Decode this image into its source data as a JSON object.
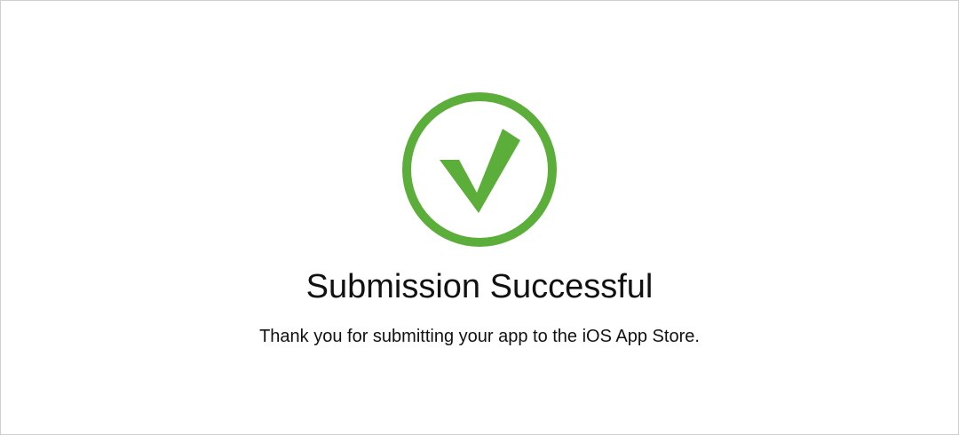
{
  "dialog": {
    "status_icon": "success-checkmark-icon",
    "accent_color": "#5cae3a",
    "title": "Submission Successful",
    "message": "Thank you for submitting your app to the iOS App Store."
  }
}
